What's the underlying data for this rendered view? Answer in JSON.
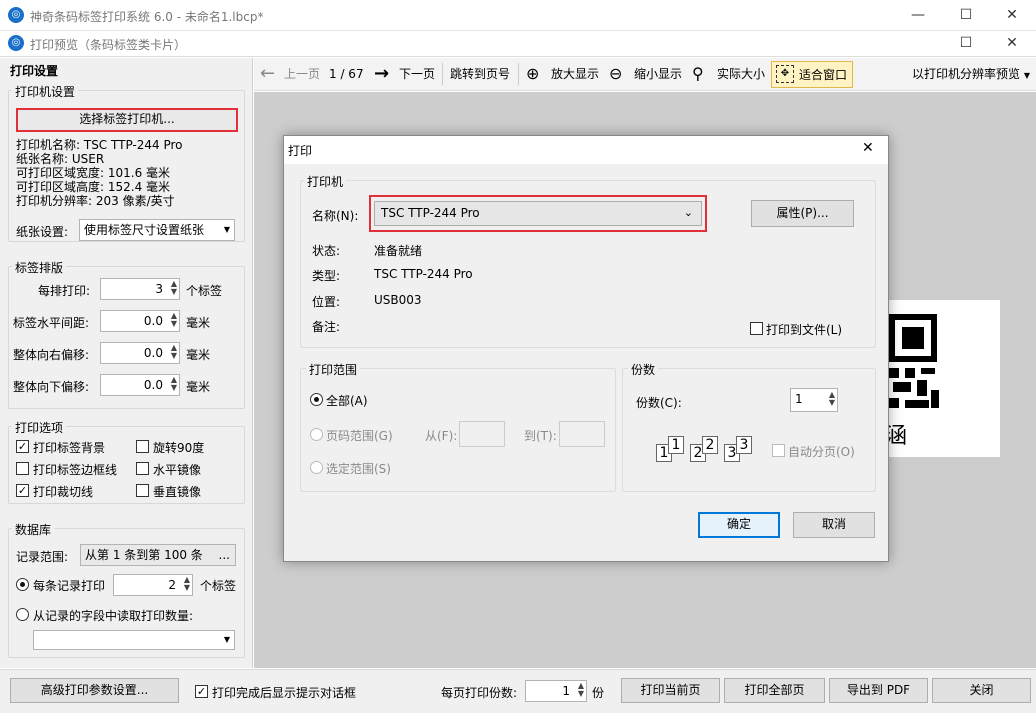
{
  "window": {
    "title": "神奇条码标签打印系统 6.0 - 未命名1.lbcp*",
    "subtitle": "打印预览（条码标签类卡片）",
    "minimize": "—",
    "maximize": "☐",
    "close": "✕"
  },
  "left": {
    "section_title": "打印设置",
    "printer_group": {
      "title": "打印机设置",
      "select_button": "选择标签打印机...",
      "info": [
        "打印机名称: TSC TTP-244 Pro",
        "纸张名称: USER",
        "可打印区域宽度: 101.6 毫米",
        "可打印区域高度: 152.4 毫米",
        "打印机分辨率: 203 像素/英寸"
      ],
      "paper_label": "纸张设置:",
      "paper_value": "使用标签尺寸设置纸张"
    },
    "layout_group": {
      "title": "标签排版",
      "rows": [
        {
          "label": "每排打印:",
          "value": "3",
          "unit": "个标签"
        },
        {
          "label": "标签水平间距:",
          "value": "0.0",
          "unit": "毫米"
        },
        {
          "label": "整体向右偏移:",
          "value": "0.0",
          "unit": "毫米"
        },
        {
          "label": "整体向下偏移:",
          "value": "0.0",
          "unit": "毫米"
        }
      ]
    },
    "options_group": {
      "title": "打印选项",
      "items": [
        {
          "label": "打印标签背景",
          "checked": true
        },
        {
          "label": "旋转90度",
          "checked": false
        },
        {
          "label": "打印标签边框线",
          "checked": false
        },
        {
          "label": "水平镜像",
          "checked": false
        },
        {
          "label": "打印裁切线",
          "checked": true
        },
        {
          "label": "垂直镜像",
          "checked": false
        }
      ]
    },
    "database_group": {
      "title": "数据库",
      "range_label": "记录范围:",
      "range_value": "从第 1 条到第 100 条",
      "range_button": "...",
      "per_record_label": "每条记录打印",
      "per_record_value": "2",
      "per_record_unit": "个标签",
      "from_field_label": "从记录的字段中读取打印数量:",
      "field_value": ""
    }
  },
  "toolbar": {
    "prev": "上一页",
    "page": "1 / 67",
    "next": "下一页",
    "goto": "跳转到页号",
    "zoom_in": "放大显示",
    "zoom_out": "缩小显示",
    "actual": "实际大小",
    "fit": "适合窗口",
    "resolution": "以打印机分辨率预览"
  },
  "preview": {
    "label_text": "涵"
  },
  "bottom": {
    "advanced": "高级打印参数设置...",
    "show_prompt": "打印完成后显示提示对话框",
    "copies_label": "每页打印份数:",
    "copies_value": "1",
    "copies_unit": "份",
    "print_current": "打印当前页",
    "print_all": "打印全部页",
    "export_pdf": "导出到 PDF",
    "close": "关闭"
  },
  "dialog": {
    "title": "打印",
    "close": "✕",
    "printer_group": "打印机",
    "name_label": "名称(N):",
    "name_value": "TSC TTP-244 Pro",
    "properties": "属性(P)...",
    "status_label": "状态:",
    "status_value": "准备就绪",
    "type_label": "类型:",
    "type_value": "TSC TTP-244 Pro",
    "location_label": "位置:",
    "location_value": "USB003",
    "comment_label": "备注:",
    "print_to_file": "打印到文件(L)",
    "range_group": "打印范围",
    "range_all": "全部(A)",
    "range_pages": "页码范围(G)",
    "range_from": "从(F):",
    "range_to": "到(T):",
    "range_selection": "选定范围(S)",
    "copies_group": "份数",
    "copies_label": "份数(C):",
    "copies_value": "1",
    "collate": "自动分页(O)",
    "ok": "确定",
    "cancel": "取消"
  },
  "colors": {
    "highlight_border": "#e0303a",
    "accent": "#0078d7",
    "preview_bg": "#cdcdcd"
  }
}
